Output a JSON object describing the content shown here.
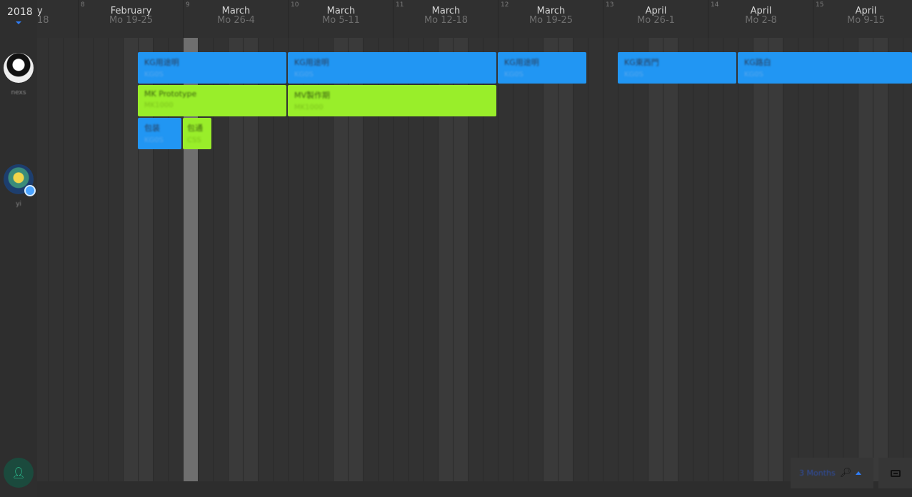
{
  "year": "2018",
  "header": {
    "prev_week": {
      "month": "y",
      "range": "18"
    },
    "weeks": [
      {
        "num": "8",
        "month": "February",
        "range": "Mo 19-25"
      },
      {
        "num": "9",
        "month": "March",
        "range": "Mo 26-4"
      },
      {
        "num": "10",
        "month": "March",
        "range": "Mo 5-11"
      },
      {
        "num": "11",
        "month": "March",
        "range": "Mo 12-18"
      },
      {
        "num": "12",
        "month": "March",
        "range": "Mo 19-25"
      },
      {
        "num": "13",
        "month": "April",
        "range": "Mo 26-1"
      },
      {
        "num": "14",
        "month": "April",
        "range": "Mo 2-8"
      },
      {
        "num": "15",
        "month": "April",
        "range": "Mo 9-15"
      }
    ]
  },
  "people": [
    {
      "name": "nexs"
    },
    {
      "name": "yi"
    }
  ],
  "events": [
    {
      "title": "KG用途明",
      "sub": "KG0S",
      "color": "blue"
    },
    {
      "title": "KG用途明",
      "sub": "KG0S",
      "color": "blue"
    },
    {
      "title": "KG用途明",
      "sub": "KG0S",
      "color": "blue"
    },
    {
      "title": "KG東西門",
      "sub": "KG0S",
      "color": "blue"
    },
    {
      "title": "KG路白",
      "sub": "KG0S",
      "color": "blue"
    },
    {
      "title": "MK Prototype",
      "sub": "MK1000",
      "color": "green"
    },
    {
      "title": "MV製作期",
      "sub": "MK1000",
      "color": "green"
    },
    {
      "title": "包装",
      "sub": "KG0S",
      "color": "blue"
    },
    {
      "title": "包通",
      "sub": "CSS",
      "color": "green"
    }
  ],
  "controls": {
    "zoom_label": "3 Months",
    "zoom_icon": "zoom-magnifier-icon",
    "inbox_icon": "inbox-icon",
    "add_user_icon": "add-user-icon"
  },
  "colors": {
    "event_blue": "#2196f3",
    "event_green": "#99ee2a",
    "accent": "#2f7df6"
  }
}
